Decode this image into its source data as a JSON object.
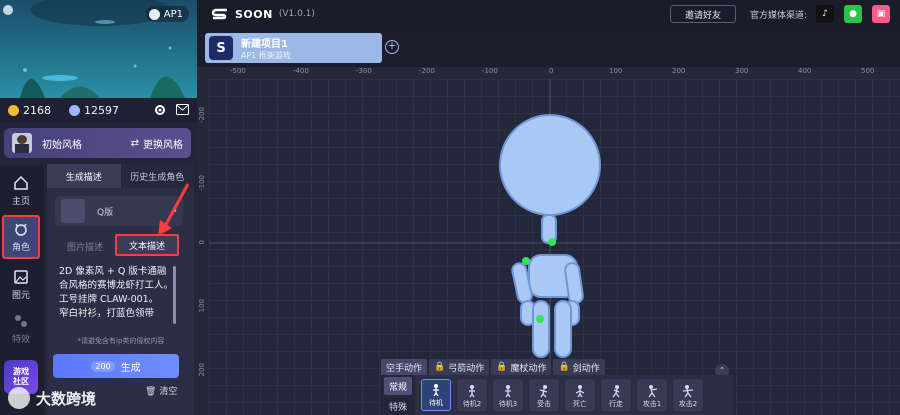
{
  "left": {
    "api_chip": "AP1",
    "stats": {
      "coins": "2168",
      "gems": "12597"
    },
    "style_card": {
      "name": "初始风格",
      "change": "更换风格"
    },
    "nav": [
      {
        "label": "主页"
      },
      {
        "label": "角色"
      },
      {
        "label": "图元"
      },
      {
        "label": "特效"
      }
    ],
    "gen": {
      "tab_desc": "生成描述",
      "tab_history": "历史生成角色",
      "version": "Q版",
      "mode_image": "图片描述",
      "mode_text": "文本描述",
      "description": "2D 像素风 + Q 版卡通融合风格的赛博龙虾打工人。\n工号挂牌 CLAW-001。\n窄白衬衫，打蓝色领带",
      "copyright_note": "*请避免含有ip类的侵权内容",
      "cost": "200",
      "generate": "生成",
      "clear": "清空"
    },
    "community": "游戏\n社区",
    "watermark": "大数跨境"
  },
  "topbar": {
    "brand": "SOON",
    "version": "(V1.0.1)",
    "invite": "邀请好友",
    "media_label": "官方媒体渠道:"
  },
  "project": {
    "title": "新建项目1",
    "subtitle": "AP1 框架游戏"
  },
  "ruler": {
    "top": [
      "-500",
      "-400",
      "-300",
      "-200",
      "-100",
      "0",
      "100",
      "200",
      "300",
      "400",
      "500",
      "600"
    ],
    "left": [
      "-200",
      "-100",
      "0",
      "100",
      "200"
    ]
  },
  "actions": {
    "tabs": [
      "空手动作",
      "弓箭动作",
      "魔杖动作",
      "剑动作"
    ],
    "categories": [
      "常规",
      "特殊"
    ],
    "items": [
      "待机",
      "待机2",
      "待机3",
      "受击",
      "死亡",
      "行走",
      "攻击1",
      "攻击2"
    ]
  },
  "colors": {
    "accent": "#6f8dff",
    "figure": "#a9c8f6",
    "joint": "#2ee65a",
    "highlight": "#ff3b3b"
  }
}
